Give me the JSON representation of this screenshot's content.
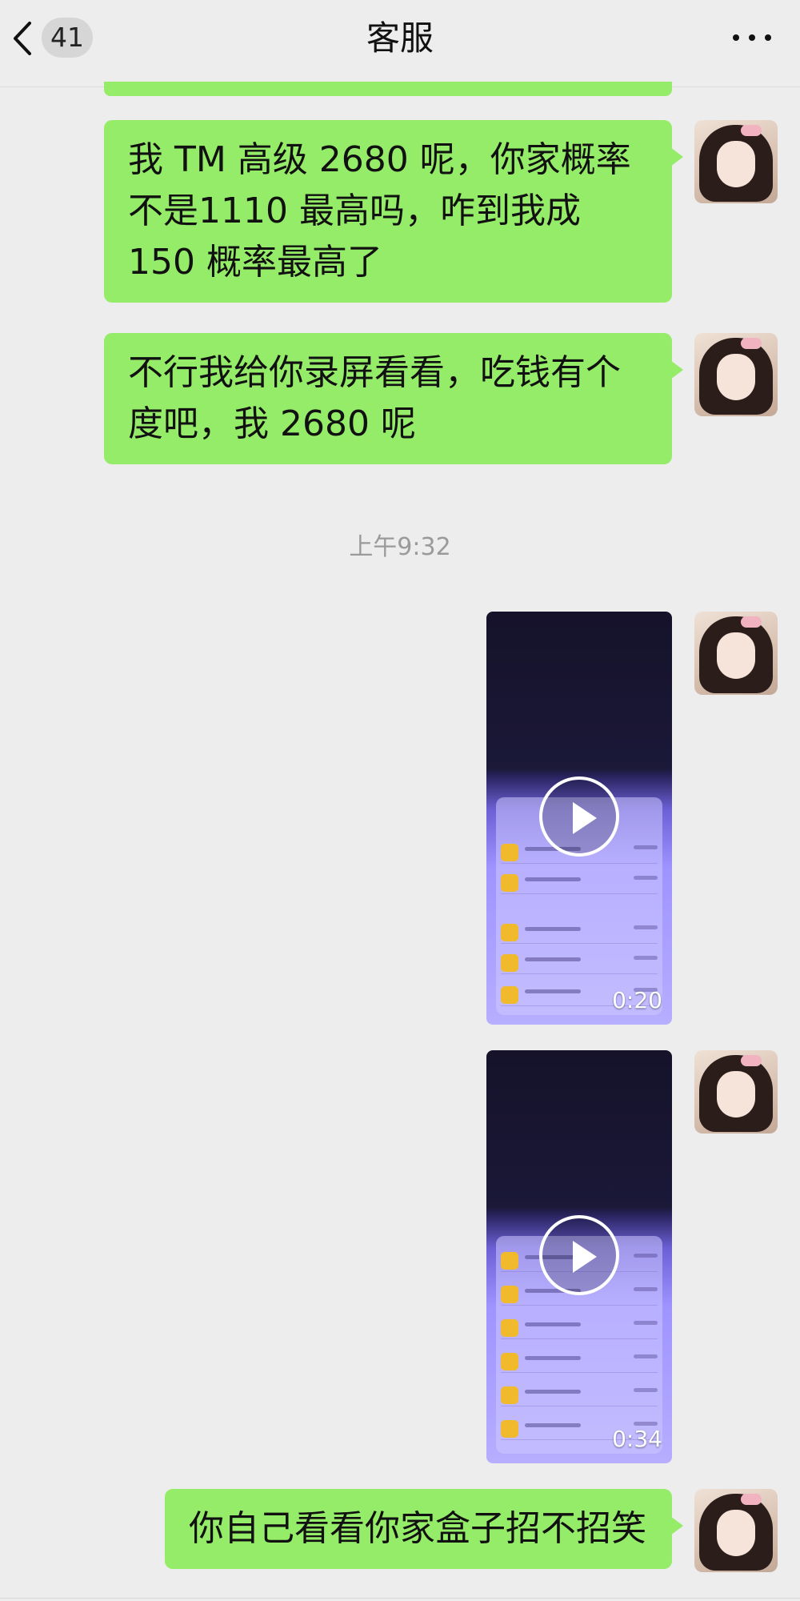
{
  "header": {
    "back_label": "返回",
    "unread_count": "41",
    "title": "客服",
    "more_icon": "more-dots-icon"
  },
  "messages": [
    {
      "type": "text",
      "text": "我 TM 高级 2680 呢，你家概率不是1110 最高吗，咋到我成 150 概率最高了"
    },
    {
      "type": "text",
      "text": "不行我给你录屏看看，吃钱有个度吧，我 2680 呢"
    },
    {
      "type": "timestamp",
      "text": "上午9:32"
    },
    {
      "type": "video",
      "duration": "0:20"
    },
    {
      "type": "video",
      "duration": "0:34"
    },
    {
      "type": "text",
      "text": "你自己看看你家盒子招不招笑"
    }
  ],
  "colors": {
    "background": "#ededed",
    "bubble": "#95ec69",
    "timestamp": "#9a9a9a"
  }
}
